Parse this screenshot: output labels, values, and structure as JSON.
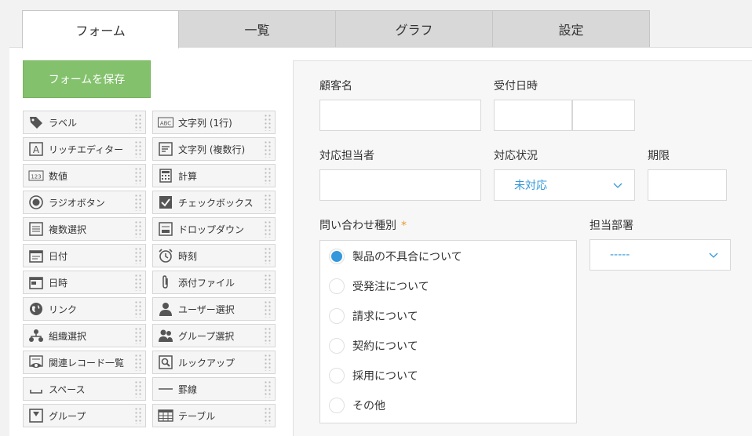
{
  "tabs": [
    {
      "label": "フォーム",
      "active": true
    },
    {
      "label": "一覧",
      "active": false
    },
    {
      "label": "グラフ",
      "active": false
    },
    {
      "label": "設定",
      "active": false
    }
  ],
  "save_button": "フォームを保存",
  "palette": {
    "left": [
      {
        "label": "ラベル",
        "icon": "tag-icon"
      },
      {
        "label": "リッチエディター",
        "icon": "rich-editor-icon"
      },
      {
        "label": "数値",
        "icon": "number-icon"
      },
      {
        "label": "ラジオボタン",
        "icon": "radio-icon"
      },
      {
        "label": "複数選択",
        "icon": "multi-select-icon"
      },
      {
        "label": "日付",
        "icon": "calendar-icon"
      },
      {
        "label": "日時",
        "icon": "datetime-icon"
      },
      {
        "label": "リンク",
        "icon": "globe-icon"
      },
      {
        "label": "組織選択",
        "icon": "org-icon"
      },
      {
        "label": "関連レコード一覧",
        "icon": "related-records-icon"
      },
      {
        "label": "スペース",
        "icon": "space-icon"
      },
      {
        "label": "グループ",
        "icon": "group-field-icon"
      }
    ],
    "right": [
      {
        "label": "文字列 (1行)",
        "icon": "text-abc-icon"
      },
      {
        "label": "文字列 (複数行)",
        "icon": "multiline-text-icon"
      },
      {
        "label": "計算",
        "icon": "calculator-icon"
      },
      {
        "label": "チェックボックス",
        "icon": "checkbox-icon"
      },
      {
        "label": "ドロップダウン",
        "icon": "dropdown-icon"
      },
      {
        "label": "時刻",
        "icon": "clock-icon"
      },
      {
        "label": "添付ファイル",
        "icon": "paperclip-icon"
      },
      {
        "label": "ユーザー選択",
        "icon": "user-icon"
      },
      {
        "label": "グループ選択",
        "icon": "users-icon"
      },
      {
        "label": "ルックアップ",
        "icon": "lookup-icon"
      },
      {
        "label": "罫線",
        "icon": "line-icon"
      },
      {
        "label": "テーブル",
        "icon": "table-icon"
      }
    ]
  },
  "form": {
    "customer_name": {
      "label": "顧客名",
      "value": ""
    },
    "received_datetime": {
      "label": "受付日時",
      "date": "",
      "time": ""
    },
    "assignee": {
      "label": "対応担当者",
      "value": ""
    },
    "status": {
      "label": "対応状況",
      "value": "未対応"
    },
    "deadline": {
      "label": "期限",
      "value": ""
    },
    "inquiry_type": {
      "label": "問い合わせ種別",
      "required_mark": "*",
      "options": [
        "製品の不具合について",
        "受発注について",
        "請求について",
        "契約について",
        "採用について",
        "その他"
      ],
      "selected_index": 0
    },
    "department": {
      "label": "担当部署",
      "value": "-----"
    }
  },
  "colors": {
    "accent": "#3498db",
    "save_green": "#83c16c",
    "required": "#e49a2b"
  }
}
